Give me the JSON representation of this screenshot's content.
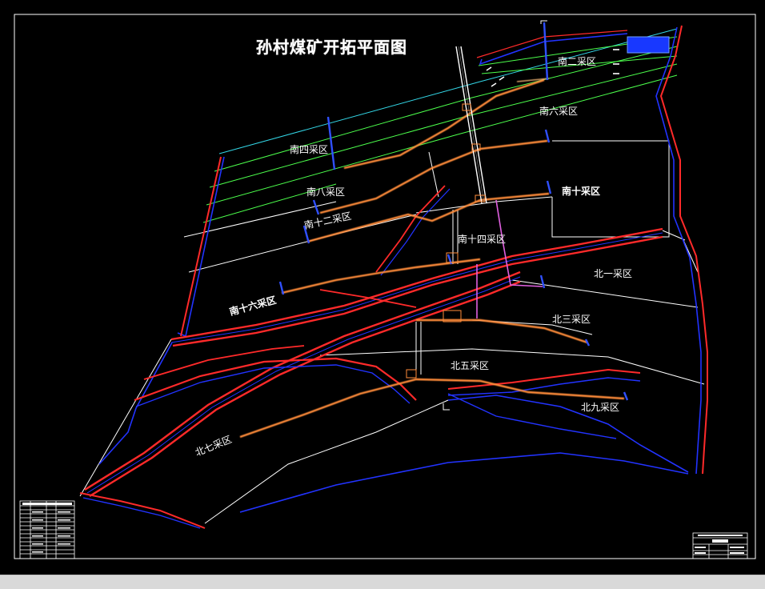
{
  "map": {
    "title": "孙村煤矿开拓平面图",
    "colors": {
      "background": "#000000",
      "boundary": "#ff2a2a",
      "boundary_inner": "#2233ff",
      "roadway": "#ff8c3a",
      "roadway_core": "#ffc07a",
      "shaft": "#ffffff",
      "seam_green": "#4cff4c",
      "seam_cyan": "#33d6e6",
      "pink": "#e060e0",
      "marker": "#3050ff",
      "goaf": "#1838ff"
    },
    "areas": [
      {
        "id": "s2",
        "label": "南二采区"
      },
      {
        "id": "s6",
        "label": "南六采区"
      },
      {
        "id": "s4",
        "label": "南四采区"
      },
      {
        "id": "s8",
        "label": "南八采区"
      },
      {
        "id": "s10",
        "label": "南十采区"
      },
      {
        "id": "s12",
        "label": "南十二采区"
      },
      {
        "id": "s14",
        "label": "南十四采区"
      },
      {
        "id": "s16",
        "label": "南十六采区"
      },
      {
        "id": "n1",
        "label": "北一采区"
      },
      {
        "id": "n3",
        "label": "北三采区"
      },
      {
        "id": "n5",
        "label": "北五采区"
      },
      {
        "id": "n7",
        "label": "北七采区"
      },
      {
        "id": "n9",
        "label": "北九采区"
      }
    ]
  }
}
